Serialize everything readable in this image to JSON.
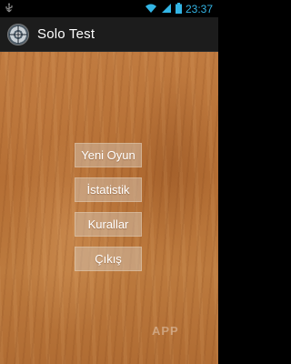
{
  "status_bar": {
    "time": "23:37",
    "icons": [
      "usb-icon",
      "wifi-icon",
      "signal-icon",
      "battery-icon"
    ],
    "accent_color": "#33b5e5"
  },
  "action_bar": {
    "title": "Solo Test",
    "icon": "app-logo-icon"
  },
  "menu": {
    "buttons": [
      {
        "label": "Yeni Oyun"
      },
      {
        "label": "İstatistik"
      },
      {
        "label": "Kurallar"
      },
      {
        "label": "Çıkış"
      }
    ]
  },
  "watermark": {
    "text": "APP"
  }
}
